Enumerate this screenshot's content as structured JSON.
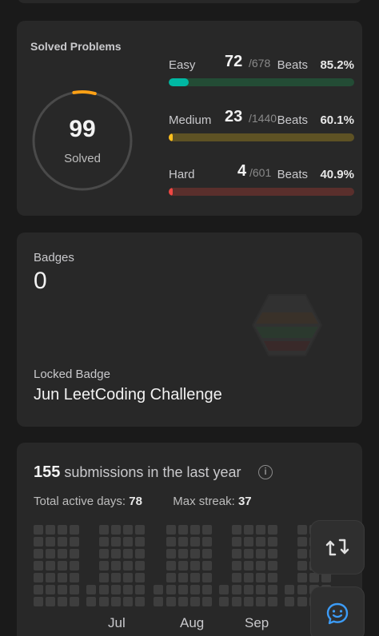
{
  "solved": {
    "title": "Solved Problems",
    "total_solved": "99",
    "total_label": "Solved",
    "difficulties": [
      {
        "name": "Easy",
        "solved": "72",
        "total": "/678",
        "beats_label": "Beats",
        "beats": "85.2%",
        "progress": 0.106,
        "fill_color": "#00b8a3",
        "track_color": "#234c35"
      },
      {
        "name": "Medium",
        "solved": "23",
        "total": "/1440",
        "beats_label": "Beats",
        "beats": "60.1%",
        "progress": 0.016,
        "fill_color": "#ffc01e",
        "track_color": "#5e5224"
      },
      {
        "name": "Hard",
        "solved": "4",
        "total": "/601",
        "beats_label": "Beats",
        "beats": "40.9%",
        "progress": 0.007,
        "fill_color": "#ef4743",
        "track_color": "#5a2f2c"
      }
    ]
  },
  "badges": {
    "label": "Badges",
    "count": "0",
    "locked_label": "Locked Badge",
    "locked_name": "Jun LeetCoding Challenge"
  },
  "submissions": {
    "count": "155",
    "text": "submissions in the last year",
    "active_days_label": "Total active days:",
    "active_days": "78",
    "max_streak_label": "Max streak:",
    "max_streak": "37",
    "months": [
      "Jul",
      "Aug",
      "Sep"
    ]
  },
  "fabs": {
    "switch_icon": "switch-layout-icon",
    "chat_icon": "chat-icon"
  },
  "colors": {
    "card": "#282828",
    "background": "#1a1a1a",
    "accent_blue": "#3c9cf7"
  }
}
